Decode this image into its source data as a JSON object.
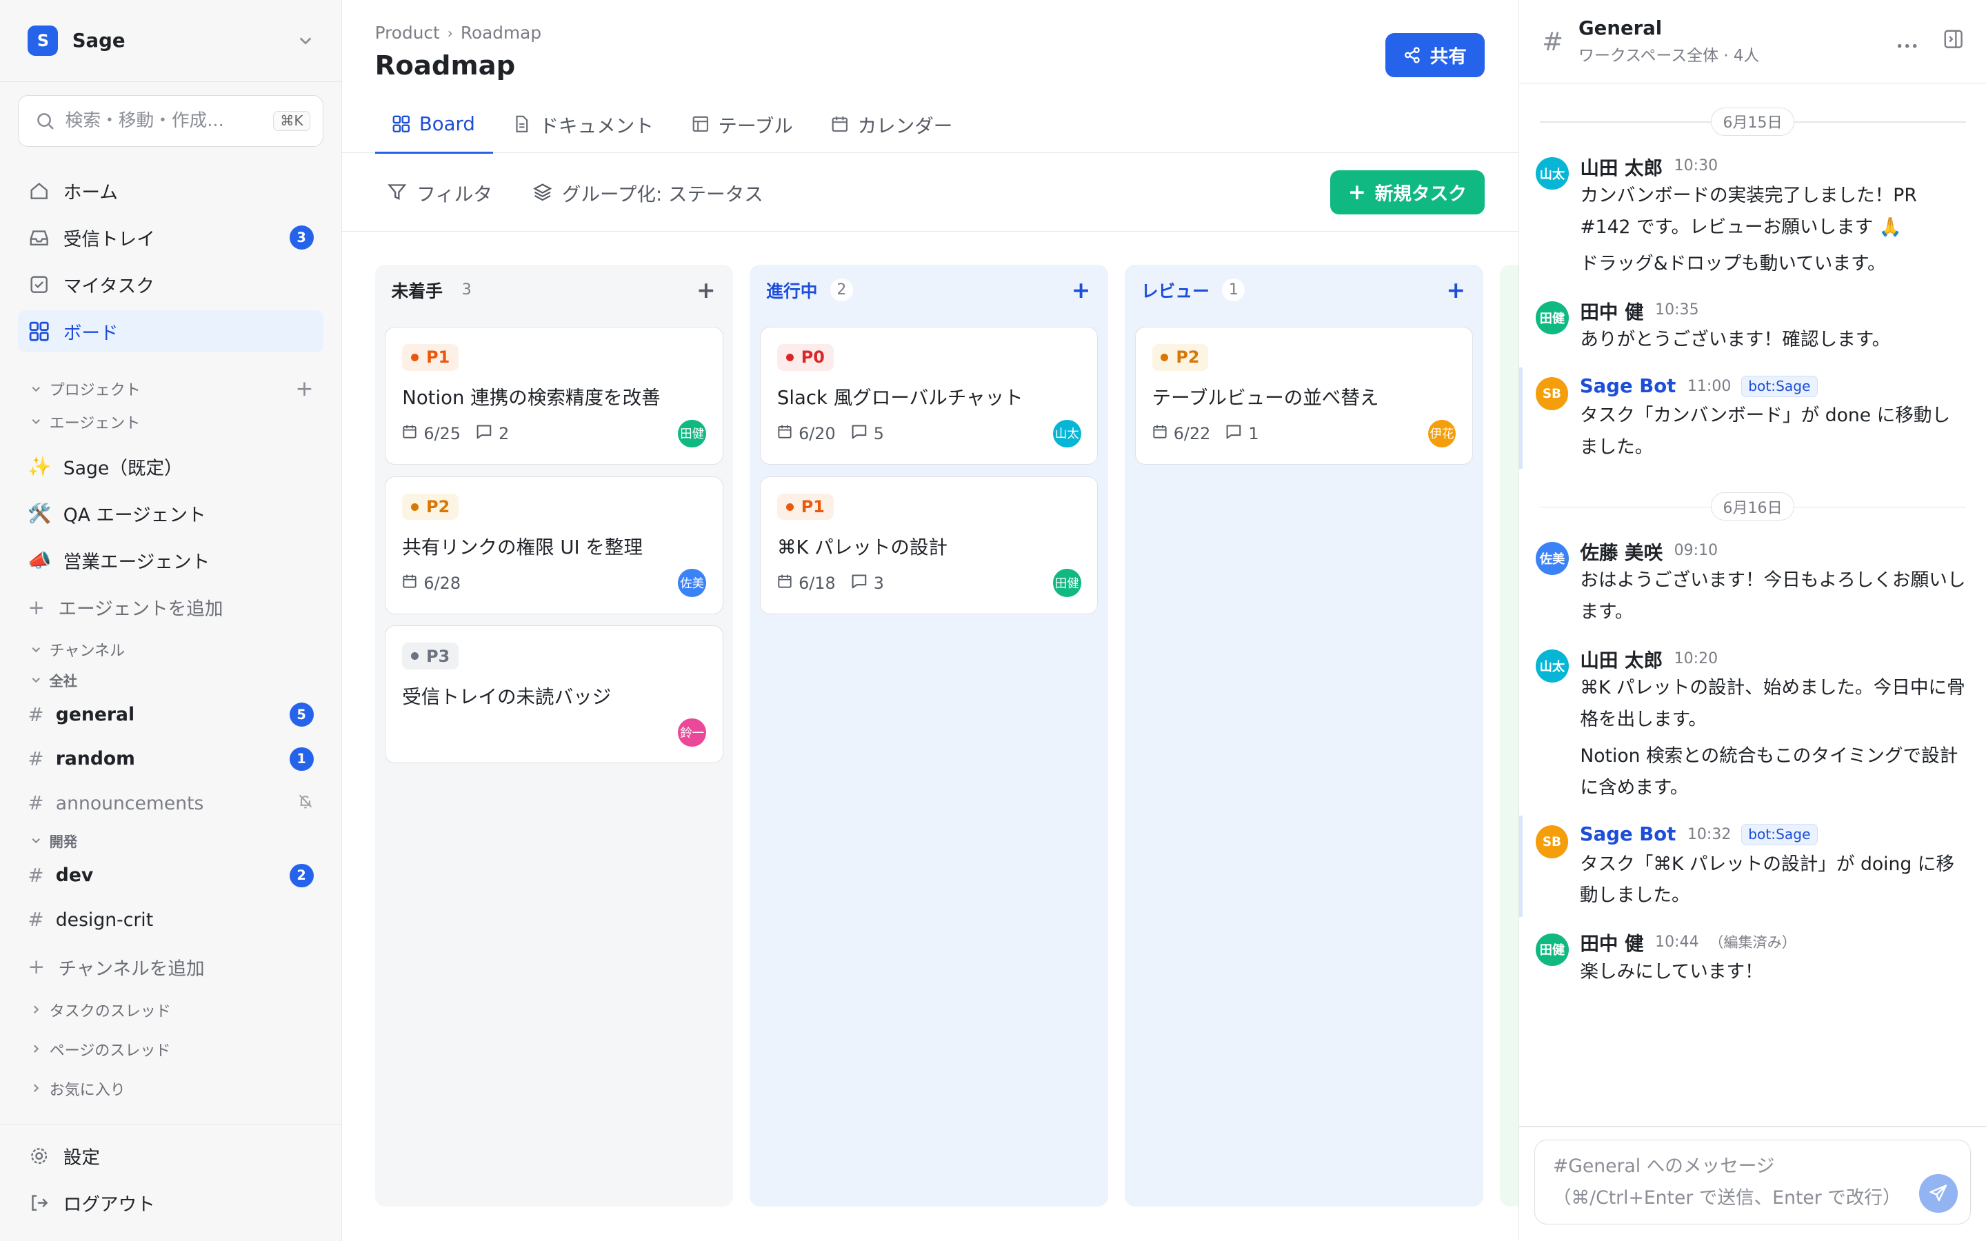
{
  "workspace": {
    "logo": "S",
    "name": "Sage"
  },
  "search": {
    "placeholder": "検索・移動・作成...",
    "shortcut": "⌘K"
  },
  "nav": [
    {
      "label": "ホーム",
      "icon": "home-icon"
    },
    {
      "label": "受信トレイ",
      "icon": "inbox-icon",
      "badge": "3"
    },
    {
      "label": "マイタスク",
      "icon": "checkbox-icon"
    },
    {
      "label": "ボード",
      "icon": "grid-icon",
      "active": true
    }
  ],
  "sections": {
    "projects": "プロジェクト",
    "agents": "エージェント",
    "channels": "チャンネル",
    "task_threads": "タスクのスレッド",
    "page_threads": "ページのスレッド",
    "favorites": "お気に入り"
  },
  "agents": [
    {
      "emoji": "✨",
      "label": "Sage（既定）"
    },
    {
      "emoji": "🛠️",
      "label": "QA エージェント"
    },
    {
      "emoji": "📣",
      "label": "営業エージェント"
    }
  ],
  "add_agent": "エージェントを追加",
  "channel_groups": {
    "company": "全社",
    "dev": "開発"
  },
  "channels_company": [
    {
      "name": "general",
      "badge": "5"
    },
    {
      "name": "random",
      "badge": "1"
    },
    {
      "name": "announcements",
      "muted": true
    }
  ],
  "channels_dev": [
    {
      "name": "dev",
      "badge": "2"
    },
    {
      "name": "design-crit"
    }
  ],
  "add_channel": "チャンネルを追加",
  "bottom": {
    "settings": "設定",
    "logout": "ログアウト"
  },
  "header": {
    "breadcrumb": [
      "Product",
      "Roadmap"
    ],
    "title": "Roadmap",
    "share": "共有",
    "tabs": [
      "Board",
      "ドキュメント",
      "テーブル",
      "カレンダー"
    ]
  },
  "toolbar": {
    "filter": "フィルタ",
    "group": "グループ化: ステータス",
    "new_task": "新規タスク"
  },
  "columns": [
    {
      "title": "未着手",
      "count": "3",
      "cards": [
        {
          "priority": "P1",
          "title": "Notion 連携の検索精度を改善",
          "date": "6/25",
          "comments": "2",
          "assignee": "田健"
        },
        {
          "priority": "P2",
          "title": "共有リンクの権限 UI を整理",
          "date": "6/28",
          "comments": "",
          "assignee": "佐美"
        },
        {
          "priority": "P3",
          "title": "受信トレイの未読バッジ",
          "date": "",
          "comments": "",
          "assignee": "鈴一"
        }
      ]
    },
    {
      "title": "進行中",
      "count": "2",
      "cards": [
        {
          "priority": "P0",
          "title": "Slack 風グローバルチャット",
          "date": "6/20",
          "comments": "5",
          "assignee": "山太"
        },
        {
          "priority": "P1",
          "title": "⌘K パレットの設計",
          "date": "6/18",
          "comments": "3",
          "assignee": "田健"
        }
      ]
    },
    {
      "title": "レビュー",
      "count": "1",
      "cards": [
        {
          "priority": "P2",
          "title": "テーブルビューの並べ替え",
          "date": "6/22",
          "comments": "1",
          "assignee": "伊花"
        }
      ]
    }
  ],
  "colors": {
    "accent": "#2563eb",
    "green": "#10b981",
    "P0": "#dc2626",
    "P1": "#ea580c",
    "P2": "#d97706",
    "P3": "#6b7280",
    "P0_bg": "#fdecec",
    "P1_bg": "#fdf0e6",
    "P2_bg": "#fdf5e3",
    "P3_bg": "#f0f1f3",
    "av_田健": "#10b981",
    "av_佐美": "#3b82f6",
    "av_鈴一": "#ec4899",
    "av_山太": "#06b6d4",
    "av_伊花": "#f59e0b",
    "av_SB": "#f59e0b"
  },
  "chat": {
    "channel": "General",
    "subtitle": "ワークスペース全体 · 4人",
    "items": [
      {
        "type": "date",
        "text": "6月15日"
      },
      {
        "type": "msg",
        "av": "山太",
        "author": "山田 太郎",
        "time": "10:30",
        "lines": [
          "カンバンボードの実装完了しました！PR #142 です。レビューお願いします 🙏",
          "ドラッグ&ドロップも動いています。"
        ]
      },
      {
        "type": "msg",
        "av": "田健",
        "author": "田中 健",
        "time": "10:35",
        "lines": [
          "ありがとうございます！確認します。"
        ]
      },
      {
        "type": "msg",
        "bot": true,
        "av": "SB",
        "author": "Sage Bot",
        "time": "11:00",
        "tag": "bot:Sage",
        "lines": [
          "タスク「カンバンボード」が done に移動しました。"
        ]
      },
      {
        "type": "date",
        "text": "6月16日"
      },
      {
        "type": "msg",
        "av": "佐美",
        "author": "佐藤 美咲",
        "time": "09:10",
        "lines": [
          "おはようございます！今日もよろしくお願いします。"
        ]
      },
      {
        "type": "msg",
        "av": "山太",
        "author": "山田 太郎",
        "time": "10:20",
        "lines": [
          "⌘K パレットの設計、始めました。今日中に骨格を出します。",
          "Notion 検索との統合もこのタイミングで設計に含めます。"
        ]
      },
      {
        "type": "msg",
        "bot": true,
        "av": "SB",
        "author": "Sage Bot",
        "time": "10:32",
        "tag": "bot:Sage",
        "lines": [
          "タスク「⌘K パレットの設計」が doing に移動しました。"
        ]
      },
      {
        "type": "msg",
        "av": "田健",
        "author": "田中 健",
        "time": "10:44",
        "edited": "（編集済み）",
        "lines": [
          "楽しみにしています！"
        ]
      }
    ],
    "composer_placeholder": "#General へのメッセージ\n（⌘/Ctrl+Enter で送信、Enter で改行）"
  }
}
